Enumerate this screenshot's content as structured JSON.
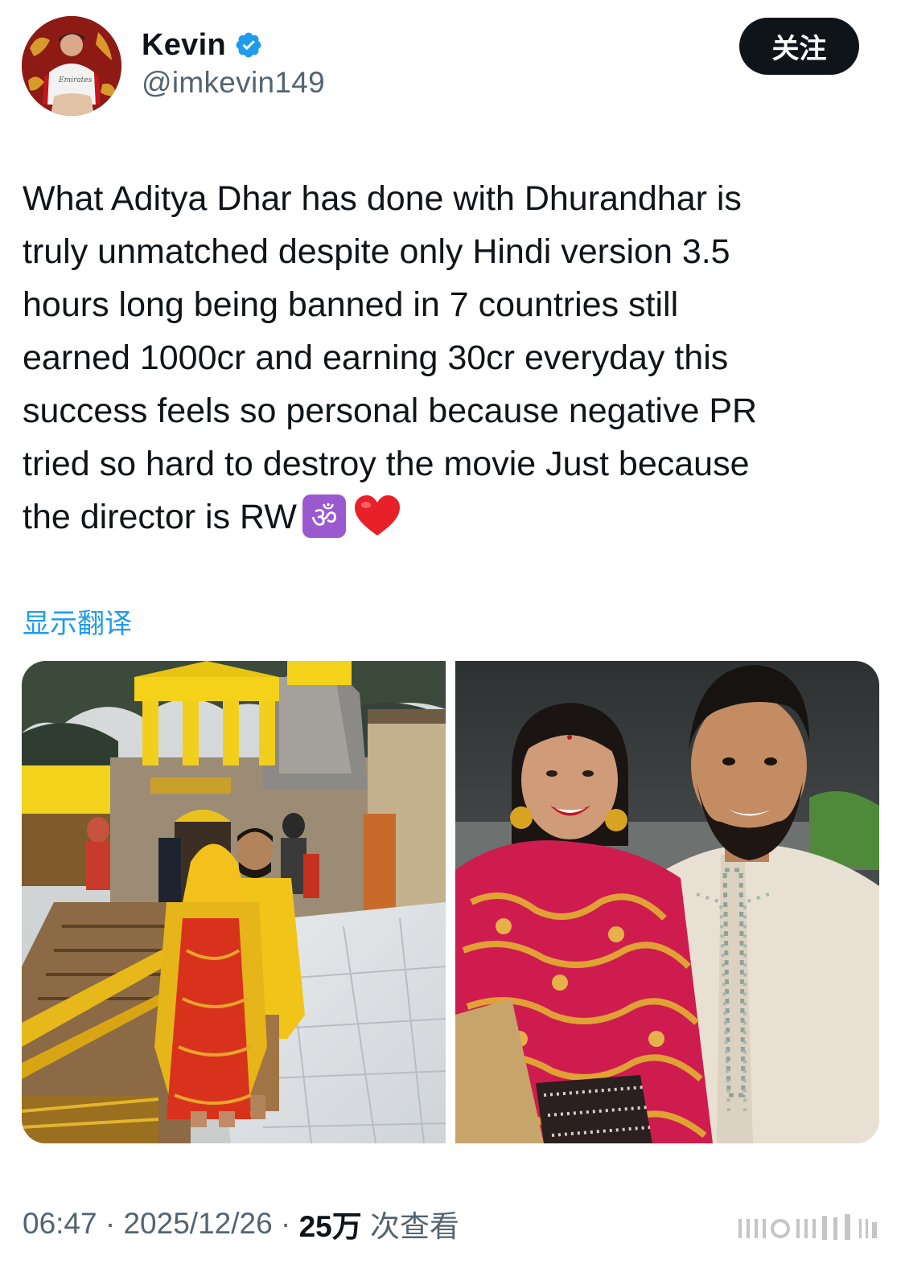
{
  "author": {
    "display_name": "Kevin",
    "handle": "@imkevin149",
    "verified": true
  },
  "header": {
    "follow_label": "关注"
  },
  "tweet": {
    "text": "What Aditya Dhar has done with Dhurandhar is\ntruly unmatched despite only Hindi version 3.5\nhours long being banned in 7 countries still\nearned 1000cr and earning 30cr everyday this\nsuccess feels so personal because negative PR\ntried so hard to destroy the movie Just because\nthe director is RW",
    "emojis": [
      "om-emoji",
      "red-heart-emoji"
    ],
    "translate_label": "显示翻译"
  },
  "media": {
    "count": 2
  },
  "meta": {
    "time": "06:47",
    "separator": " · ",
    "date": "2025/12/26",
    "views_count": "25万",
    "views_label": "次查看"
  },
  "colors": {
    "link": "#1d9bf0",
    "text": "#0f1419",
    "muted": "#536471",
    "verified": "#1d9bf0",
    "button_bg": "#0f1419"
  }
}
